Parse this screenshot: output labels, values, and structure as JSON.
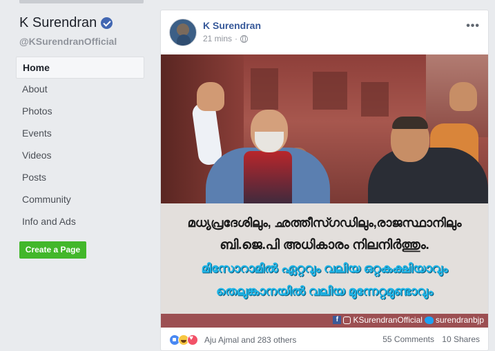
{
  "page": {
    "name": "K Surendran",
    "handle": "@KSurendranOfficial"
  },
  "nav": {
    "items": [
      {
        "label": "Home",
        "active": true
      },
      {
        "label": "About"
      },
      {
        "label": "Photos"
      },
      {
        "label": "Events"
      },
      {
        "label": "Videos"
      },
      {
        "label": "Posts"
      },
      {
        "label": "Community"
      },
      {
        "label": "Info and Ads"
      }
    ]
  },
  "create_page_label": "Create a Page",
  "post": {
    "author": "K Surendran",
    "time": "21 mins",
    "dot": "·",
    "more": "•••",
    "image_text": {
      "line1": "മധ്യപ്രദേശിലും, ഛത്തീസ്ഗഡിലും,രാജസ്ഥാനിലും",
      "line2": "ബി.ജെ.പി അധികാരം നിലനിർത്തും.",
      "line3": "മിസോറാമിൽ ഏറ്റവും വലിയ ഒറ്റകക്ഷിയാവും",
      "line4": "തെലുങ്കാനയിൽ വലിയ മുന്നേറ്റമുണ്ടാവും",
      "credit_fb": "KSurendranOfficial",
      "credit_tw": "surendranbjp"
    },
    "reactors": "Aju Ajmal and 283 others",
    "comments": "55 Comments",
    "shares": "10 Shares"
  },
  "colors": {
    "accent": "#365899",
    "create_button": "#42b72a",
    "banner_cyan": "#1fb4e6",
    "banner_bar": "#9c4f52"
  }
}
